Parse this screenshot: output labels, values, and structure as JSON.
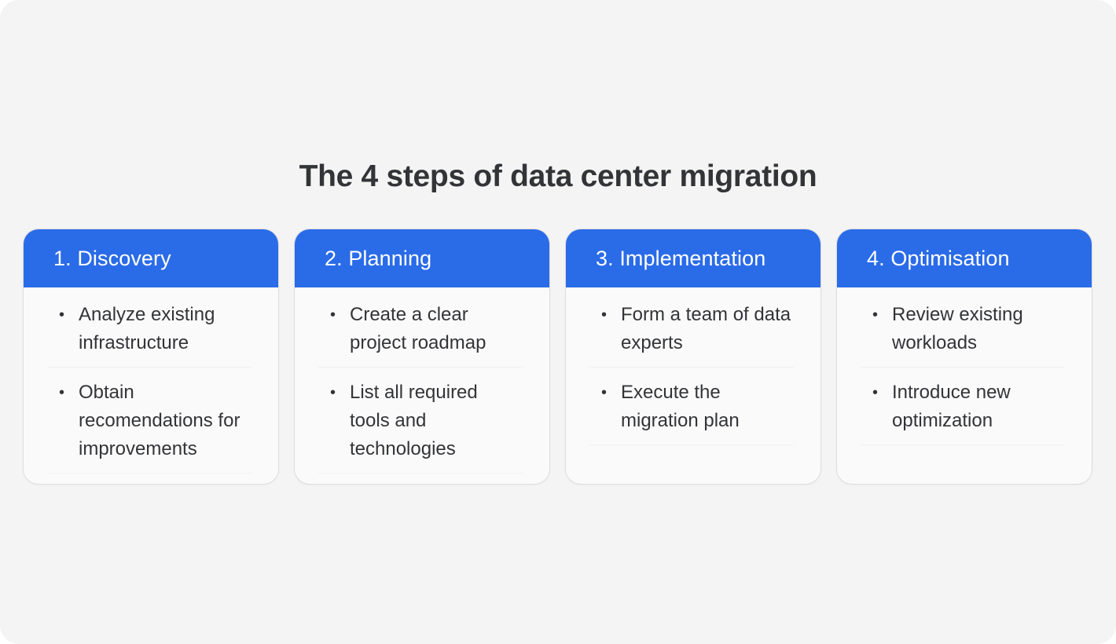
{
  "title": "The 4 steps of data center migration",
  "colors": {
    "accent": "#2a6be8",
    "background": "#f4f4f4",
    "card_background": "#fafafa",
    "text": "#333437"
  },
  "steps": [
    {
      "label": "1. Discovery",
      "items": [
        "Analyze existing infrastructure",
        "Obtain recomendations for improvements"
      ]
    },
    {
      "label": "2. Planning",
      "items": [
        "Create a clear project roadmap",
        "List all required tools and technologies"
      ]
    },
    {
      "label": "3. Implementation",
      "items": [
        "Form a team of data experts",
        "Execute the migration plan"
      ]
    },
    {
      "label": "4. Optimisation",
      "items": [
        "Review existing workloads",
        "Introduce new optimization"
      ]
    }
  ]
}
